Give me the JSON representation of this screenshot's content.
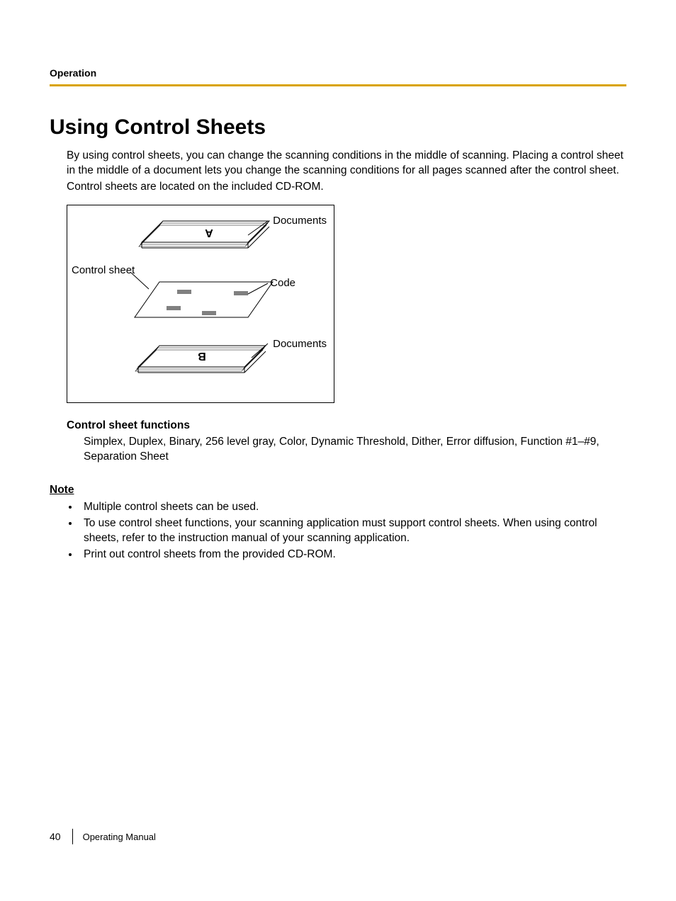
{
  "header": {
    "section": "Operation"
  },
  "title": "Using Control Sheets",
  "paragraphs": {
    "p1": "By using control sheets, you can change the scanning conditions in the middle of scanning. Placing a control sheet in the middle of a document lets you change the scanning conditions for all pages scanned after the control sheet.",
    "p2": "Control sheets are located on the included CD-ROM."
  },
  "diagram": {
    "label_documents_top": "Documents",
    "label_control_sheet": "Control sheet",
    "label_code": "Code",
    "label_documents_bottom": "Documents"
  },
  "functions": {
    "heading": "Control sheet functions",
    "text": "Simplex, Duplex, Binary, 256 level gray, Color, Dynamic Threshold, Dither, Error diffusion, Function #1–#9, Separation Sheet"
  },
  "note": {
    "heading": "Note",
    "items": [
      "Multiple control sheets can be used.",
      "To use control sheet functions, your scanning application must support control sheets. When using control sheets, refer to the instruction manual of your scanning application.",
      "Print out control sheets from the provided CD-ROM."
    ]
  },
  "footer": {
    "page_number": "40",
    "doc_title": "Operating Manual"
  }
}
